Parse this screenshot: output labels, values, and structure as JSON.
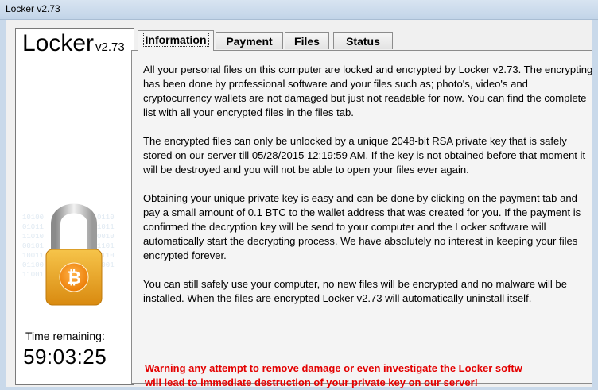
{
  "window": {
    "title": "Locker v2.73"
  },
  "logo": {
    "name": "Locker",
    "version": "v2.73"
  },
  "timer": {
    "label": "Time remaining:",
    "value": "59:03:25"
  },
  "tabs": [
    {
      "label": "Information",
      "active": true
    },
    {
      "label": "Payment",
      "active": false
    },
    {
      "label": "Files",
      "active": false
    },
    {
      "label": "Status",
      "active": false
    }
  ],
  "information": {
    "paragraphs": [
      "All your personal files on this computer are locked and encrypted by Locker v2.73. The encrypting has been done by professional software and your files such as; photo's, video's and  cryptocurrency wallets are not damaged but just not readable for now. You can find the complete list with all your encrypted files in the files tab.",
      "The encrypted files can only be unlocked by a unique 2048-bit RSA private key that is safely stored on our server till 05/28/2015 12:19:59 AM. If the key is not obtained before that moment it will be destroyed and you will not be able to open your files ever again.",
      "Obtaining your unique private key is easy and can be done by clicking on the payment tab and pay a small amount of 0.1 BTC to the wallet address that was created for you. If the payment is confirmed the decryption key will be send to your computer and the Locker software will automatically start the decrypting process. We have absolutely no interest in keeping your files encrypted forever.",
      "You can still safely use your computer, no new files will be encrypted and no malware will be installed. When the files are encrypted Locker v2.73 will automatically uninstall itself."
    ],
    "warning_line1": "Warning any attempt to remove damage or even investigate the Locker softw",
    "warning_line2": "will lead to immediate destruction of your private key on our server!"
  },
  "colors": {
    "warning": "#e40000",
    "lock_body": "#e8a020",
    "coin": "#f7931a"
  },
  "icons": {
    "lock": "padlock-bitcoin-icon"
  }
}
